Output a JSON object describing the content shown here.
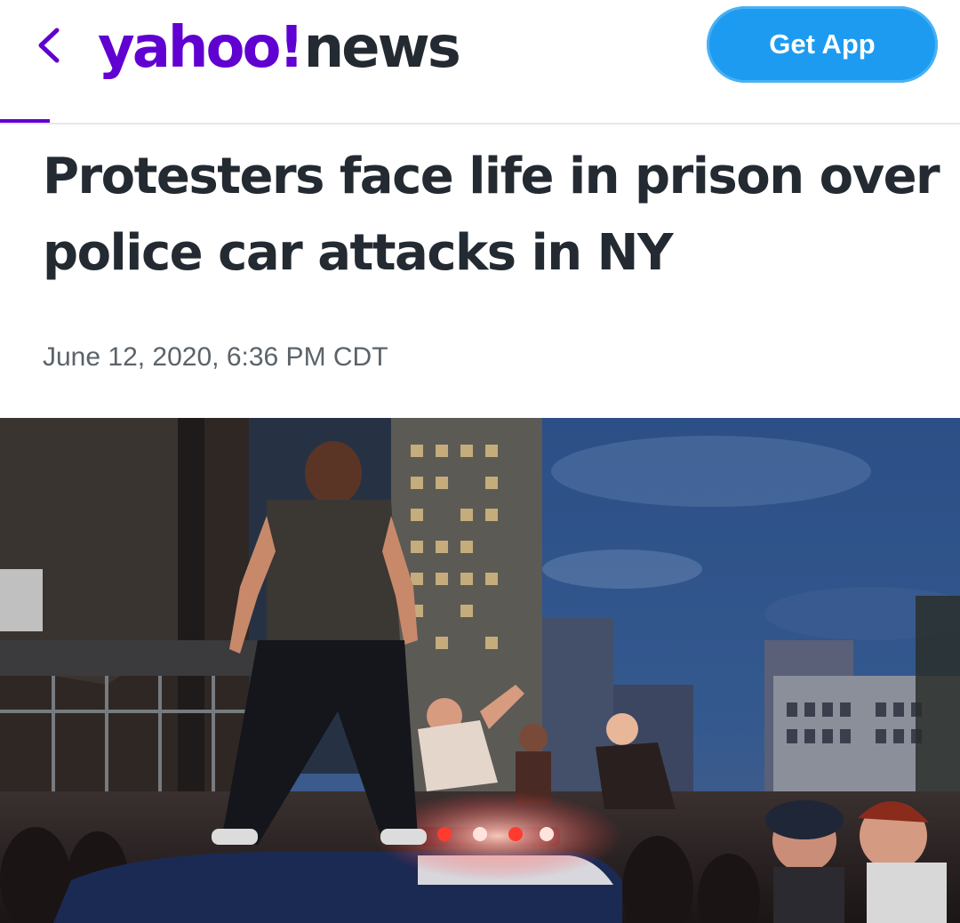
{
  "header": {
    "back_icon": "chevron-left-icon",
    "logo": {
      "brand": "yahoo!",
      "section": "news"
    },
    "get_app_label": "Get App"
  },
  "colors": {
    "brand_purple": "#6001d2",
    "button_blue": "#1d9bf0",
    "headline_text": "#232a31",
    "meta_text": "#5b636a"
  },
  "article": {
    "title": "Protesters face life in prison over police car attacks in NY",
    "timestamp": "June 12, 2020, 6:36 PM CDT"
  }
}
